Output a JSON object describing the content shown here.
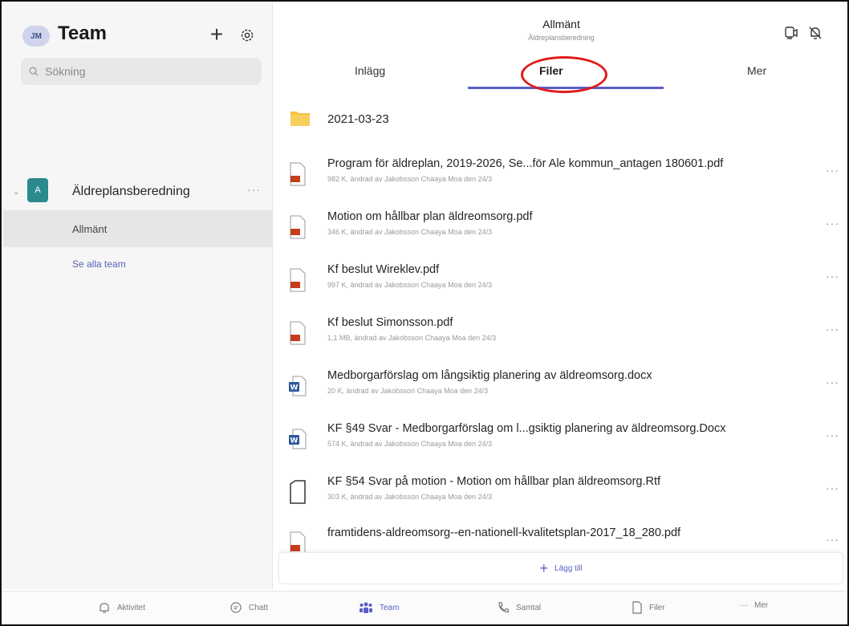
{
  "sidebar": {
    "avatar_initials": "JM",
    "title": "Team",
    "search_placeholder": "Sökning",
    "team": {
      "tile_letter": "A",
      "name": "Äldreplansberedning",
      "more": "···"
    },
    "channel": "Allmänt",
    "see_all": "Se alla team"
  },
  "channel_header": {
    "title": "Allmänt",
    "subtitle": "Äldreplansberedning"
  },
  "tabs": [
    {
      "label": "Inlägg"
    },
    {
      "label": "Filer",
      "active": true
    },
    {
      "label": "Mer"
    }
  ],
  "folder": {
    "name": "2021-03-23",
    "icon": "folder-icon"
  },
  "files": [
    {
      "name": "Program för äldreplan, 2019-2026, Se...för Ale kommun_antagen 180601.pdf",
      "meta": "982 K, ändrad av Jakobsson Chaaya Moa den 24/3",
      "icon": "pdf-file-icon"
    },
    {
      "name": "Motion om hållbar plan äldreomsorg.pdf",
      "meta": "346 K, ändrad av Jakobsson Chaaya Moa den 24/3",
      "icon": "pdf-file-icon"
    },
    {
      "name": "Kf beslut Wireklev.pdf",
      "meta": "997 K, ändrad av Jakobsson Chaaya Moa den 24/3",
      "icon": "pdf-file-icon"
    },
    {
      "name": "Kf beslut Simonsson.pdf",
      "meta": "1,1 MB, ändrad av Jakobsson Chaaya Moa den 24/3",
      "icon": "pdf-file-icon"
    },
    {
      "name": "Medborgarförslag om långsiktig planering av äldreomsorg.docx",
      "meta": "20 K, ändrad av Jakobsson Chaaya Moa den 24/3",
      "icon": "word-file-icon"
    },
    {
      "name": "KF §49 Svar - Medborgarförslag om l...gsiktig planering av äldreomsorg.Docx",
      "meta": "574 K, ändrad av Jakobsson Chaaya Moa den 24/3",
      "icon": "word-file-icon"
    },
    {
      "name": "KF §54 Svar på motion - Motion om hållbar plan äldreomsorg.Rtf",
      "meta": "303 K, ändrad av Jakobsson Chaaya Moa den 24/3",
      "icon": "generic-file-icon"
    },
    {
      "name": "framtidens-aldreomsorg--en-nationell-kvalitetsplan-2017_18_280.pdf",
      "meta": "",
      "icon": "pdf-file-icon"
    }
  ],
  "more_glyph": "···",
  "add_button": {
    "plus": "+",
    "label": "Lägg till"
  },
  "bottom_nav": [
    {
      "label": "Aktivitet",
      "icon": "bell-icon"
    },
    {
      "label": "Chatt",
      "icon": "chat-icon"
    },
    {
      "label": "Team",
      "icon": "team-icon",
      "active": true
    },
    {
      "label": "Samtal",
      "icon": "phone-icon"
    },
    {
      "label": "Filer",
      "icon": "file-icon"
    },
    {
      "label": "Mer",
      "icon": "more-icon"
    }
  ],
  "colors": {
    "accent": "#5b5fc7",
    "team_tile": "#2b8a8e",
    "highlight": "#e01b1b",
    "pdf": "#c43e1c",
    "word": "#2b579a",
    "folder": "#f5c342"
  }
}
